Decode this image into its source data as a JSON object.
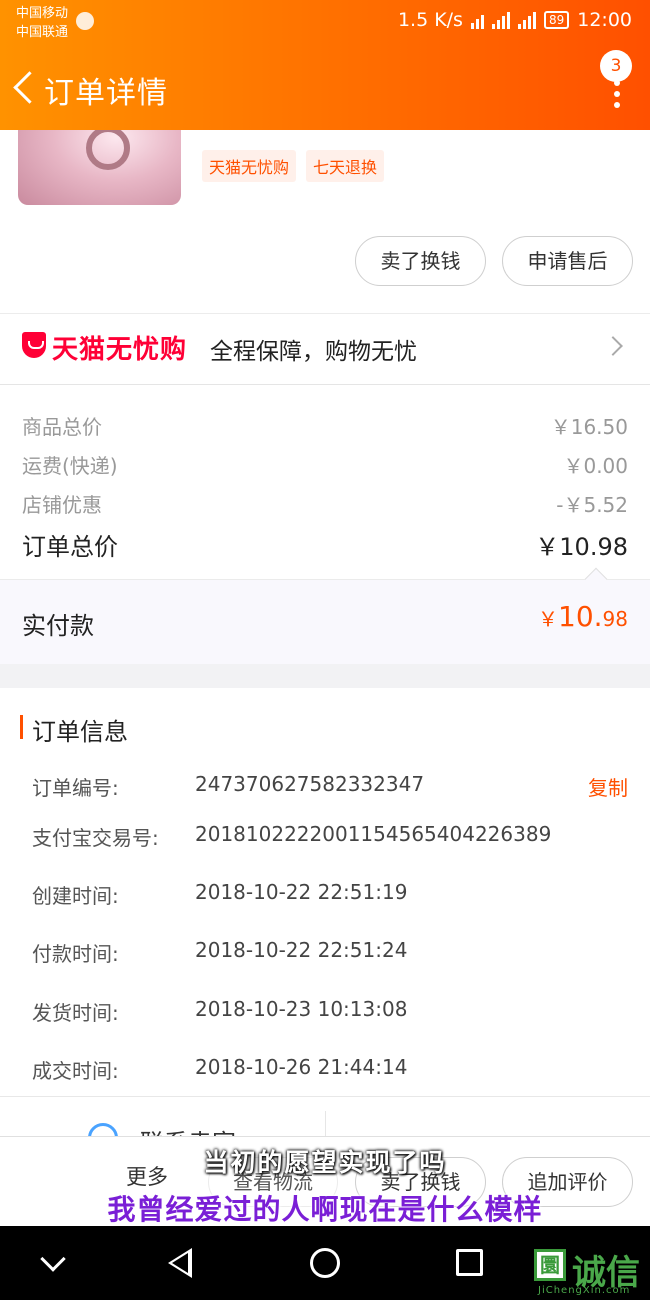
{
  "status_bar": {
    "carrier1": "中国移动",
    "carrier2": "中国联通",
    "speed": "1.5 K/s",
    "battery": "89",
    "time": "12:00"
  },
  "header": {
    "title": "订单详情",
    "notification_count": "3"
  },
  "product": {
    "tags": [
      "天猫无忧购",
      "七天退换"
    ],
    "buttons": [
      "卖了换钱",
      "申请售后"
    ]
  },
  "guarantee": {
    "brand": "天猫无忧购",
    "text": "全程保障，购物无忧"
  },
  "prices": {
    "rows": [
      {
        "label": "商品总价",
        "value": "￥16.50"
      },
      {
        "label": "运费(快递)",
        "value": "￥0.00"
      },
      {
        "label": "店铺优惠",
        "value": "-￥5.52"
      },
      {
        "label": "订单总价",
        "value": "￥10.98"
      }
    ],
    "paid_label": "实付款",
    "paid_currency": "￥",
    "paid_integer": "10.",
    "paid_decimal": "98"
  },
  "order_info": {
    "title": "订单信息",
    "copy_label": "复制",
    "rows": [
      {
        "label": "订单编号:",
        "value": "247370627582332347"
      },
      {
        "label": "支付宝交易号:",
        "value": "2018102222001154565404226389"
      },
      {
        "label": "创建时间:",
        "value": "2018-10-22 22:51:19"
      },
      {
        "label": "付款时间:",
        "value": "2018-10-22 22:51:24"
      },
      {
        "label": "发货时间:",
        "value": "2018-10-23 10:13:08"
      },
      {
        "label": "成交时间:",
        "value": "2018-10-26 21:44:14"
      }
    ]
  },
  "contact": {
    "label": "联系卖家"
  },
  "actions": {
    "more": "更多",
    "buttons": [
      "查看物流",
      "卖了换钱",
      "追加评价"
    ]
  },
  "subtitles": {
    "line1": "当初的愿望实现了吗",
    "line2": "我曾经爱过的人啊现在是什么模样"
  },
  "watermark": {
    "logo_char": "圜",
    "text": "诚信",
    "url": "JiChengXin.com"
  },
  "colors": {
    "accent": "#ff5000",
    "brand_red": "#ff0036"
  }
}
